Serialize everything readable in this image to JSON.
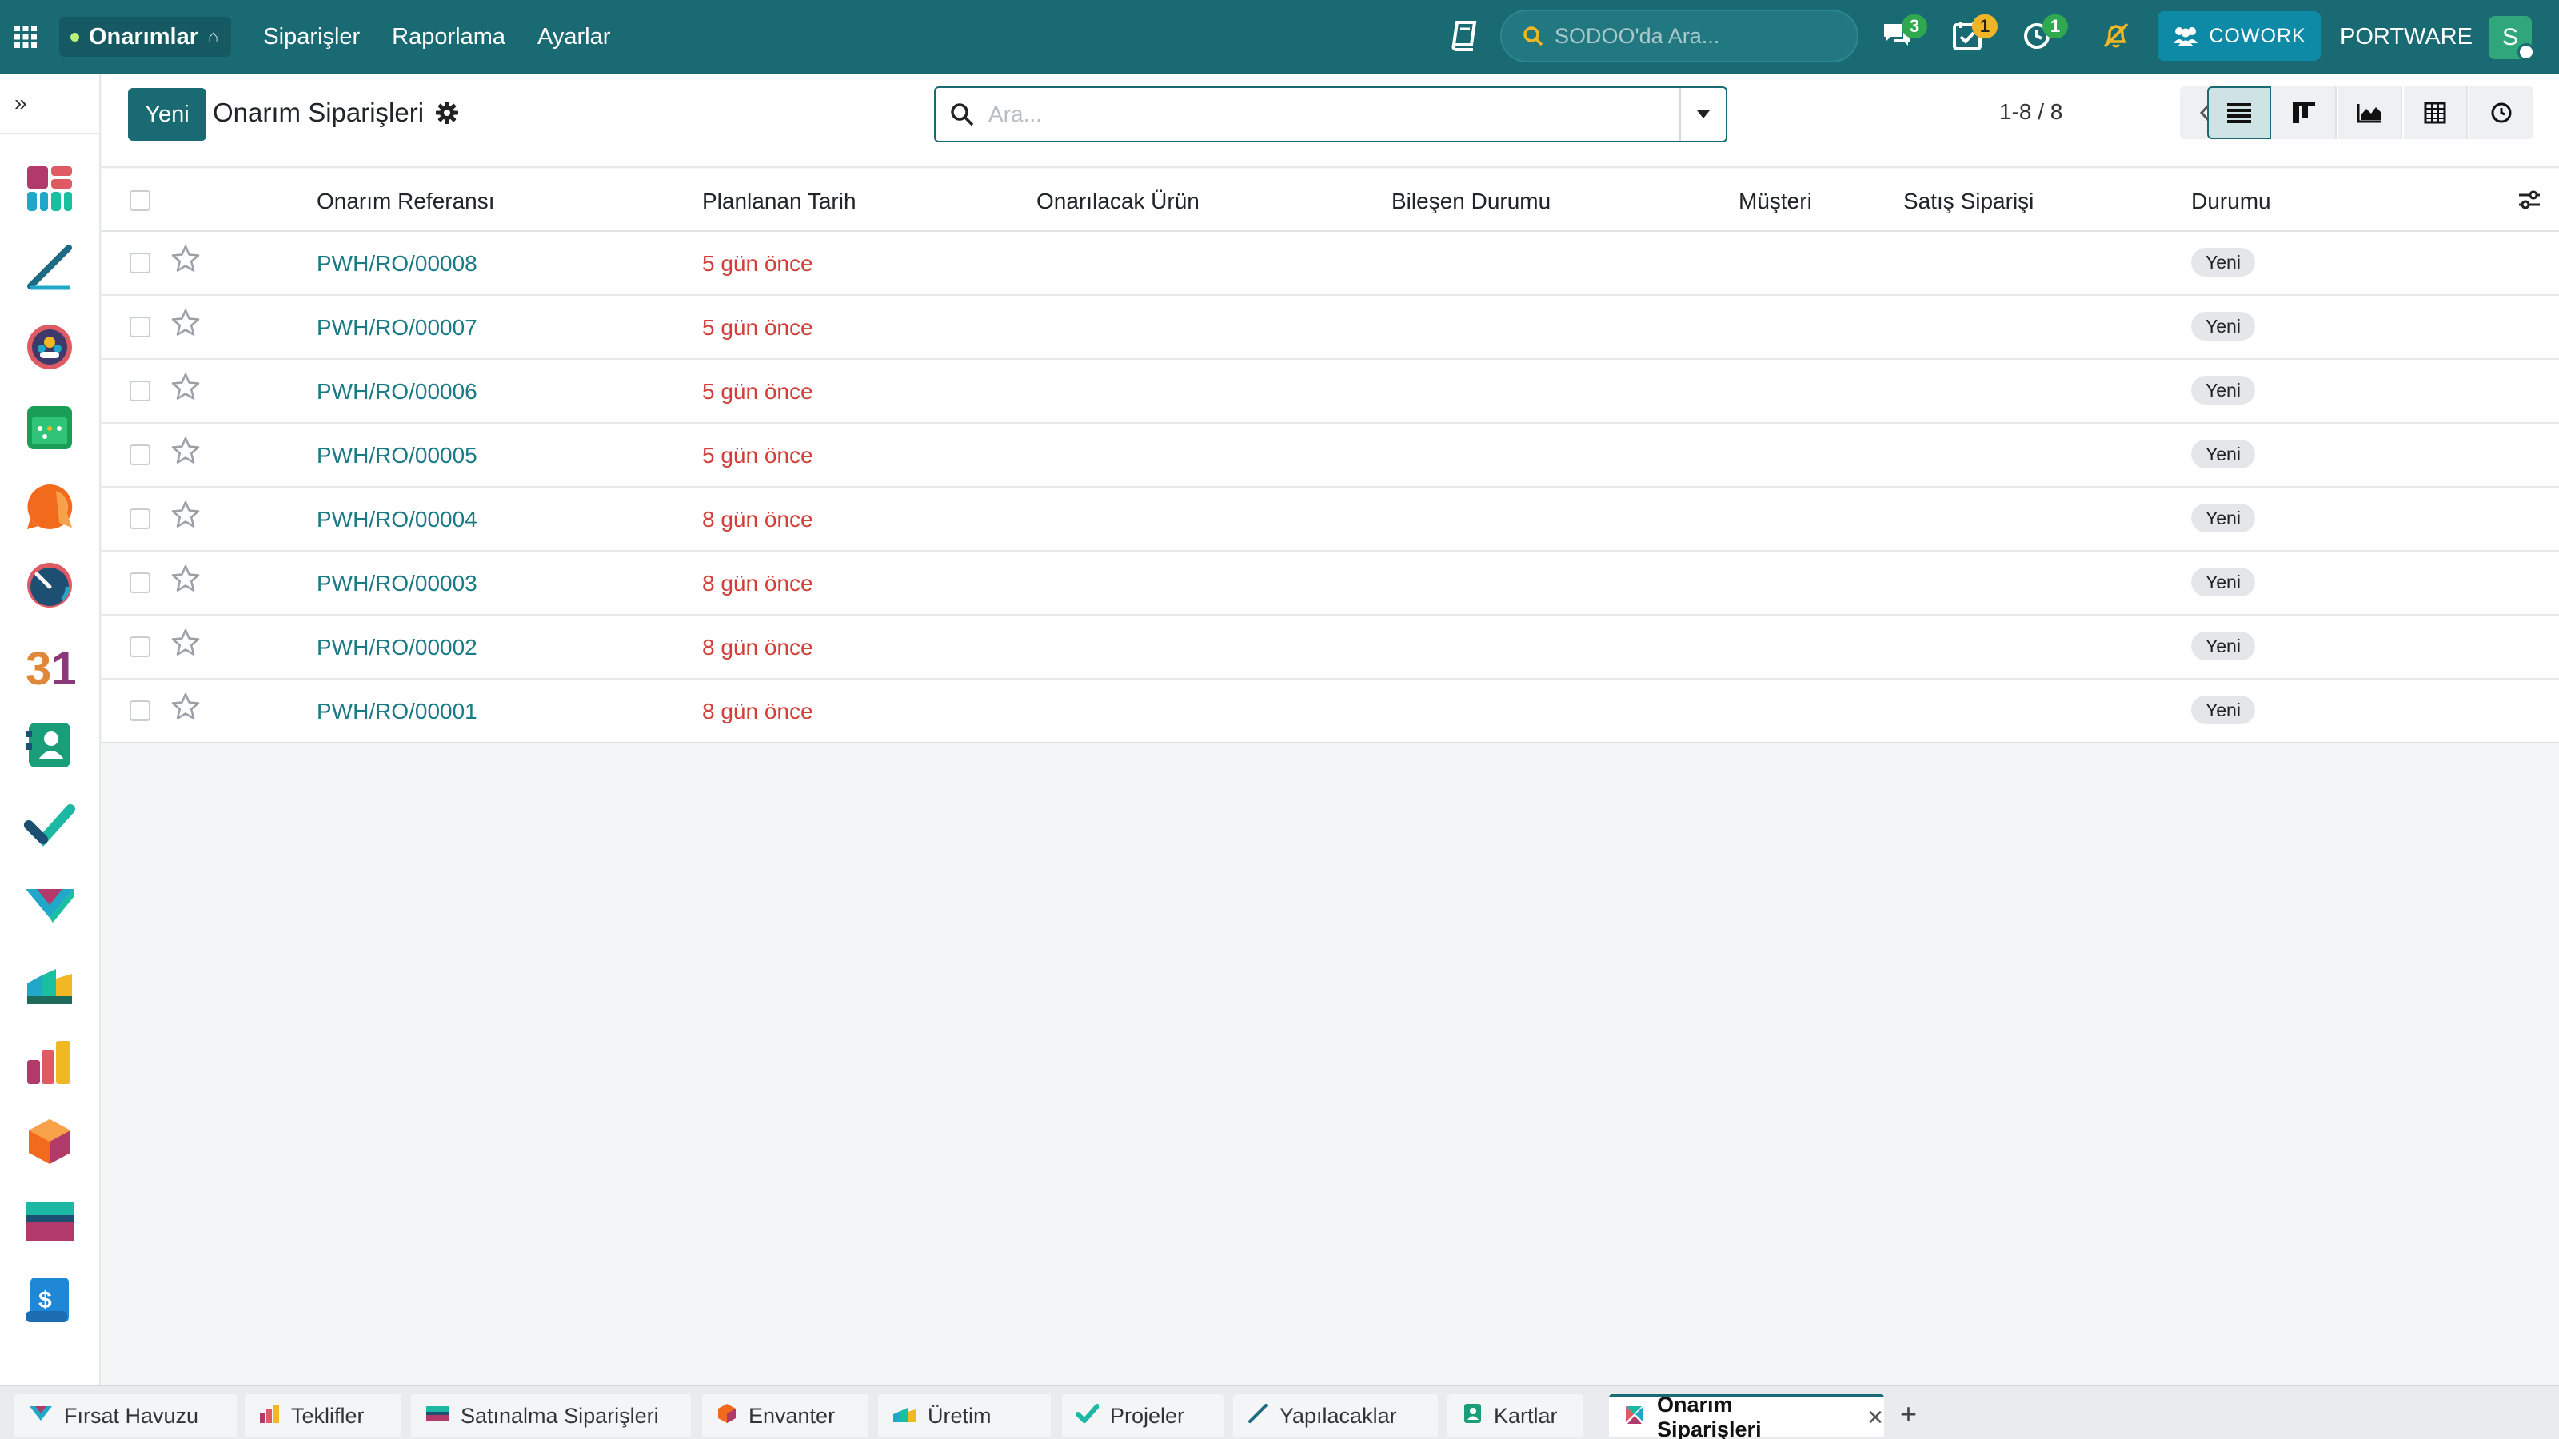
{
  "navbar": {
    "app_name": "Onarımlar",
    "menu": [
      "Siparişler",
      "Raporlama",
      "Ayarlar"
    ],
    "global_search_placeholder": "SODOO'da Ara...",
    "messages_count": "3",
    "activities_count": "1",
    "timer_count": "1",
    "cowork_label": "COWORK",
    "company": "PORTWARE",
    "avatar_letter": "S"
  },
  "sidebar": {
    "apps": [
      "dashboard-icon",
      "pen-icon",
      "team-icon",
      "calendar-icon",
      "chat-icon",
      "dial-icon",
      "calendar-31-icon",
      "contacts-icon",
      "check-icon",
      "handshake-icon",
      "factory-icon",
      "bar-icon",
      "cube-icon",
      "card-icon",
      "invoice-icon"
    ]
  },
  "control_panel": {
    "new_label": "Yeni",
    "title": "Onarım Siparişleri",
    "search_placeholder": "Ara...",
    "pager": "1-8 / 8"
  },
  "table": {
    "columns": [
      "Onarım Referansı",
      "Planlanan Tarih",
      "Onarılacak Ürün",
      "Bileşen Durumu",
      "Müşteri",
      "Satış Siparişi",
      "Durumu"
    ],
    "rows": [
      {
        "ref": "PWH/RO/00008",
        "date": "5 gün önce",
        "state": "Yeni"
      },
      {
        "ref": "PWH/RO/00007",
        "date": "5 gün önce",
        "state": "Yeni"
      },
      {
        "ref": "PWH/RO/00006",
        "date": "5 gün önce",
        "state": "Yeni"
      },
      {
        "ref": "PWH/RO/00005",
        "date": "5 gün önce",
        "state": "Yeni"
      },
      {
        "ref": "PWH/RO/00004",
        "date": "8 gün önce",
        "state": "Yeni"
      },
      {
        "ref": "PWH/RO/00003",
        "date": "8 gün önce",
        "state": "Yeni"
      },
      {
        "ref": "PWH/RO/00002",
        "date": "8 gün önce",
        "state": "Yeni"
      },
      {
        "ref": "PWH/RO/00001",
        "date": "8 gün önce",
        "state": "Yeni"
      }
    ]
  },
  "tabs": [
    {
      "label": "Fırsat Havuzu"
    },
    {
      "label": "Teklifler"
    },
    {
      "label": "Satınalma Siparişleri"
    },
    {
      "label": "Envanter"
    },
    {
      "label": "Üretim"
    },
    {
      "label": "Projeler"
    },
    {
      "label": "Yapılacaklar"
    },
    {
      "label": "Kartlar"
    },
    {
      "label": "Onarım Siparişleri",
      "active": true
    }
  ],
  "colors": {
    "brand": "#1a6a73",
    "link": "#1a7a86",
    "overdue": "#d23f3a"
  }
}
